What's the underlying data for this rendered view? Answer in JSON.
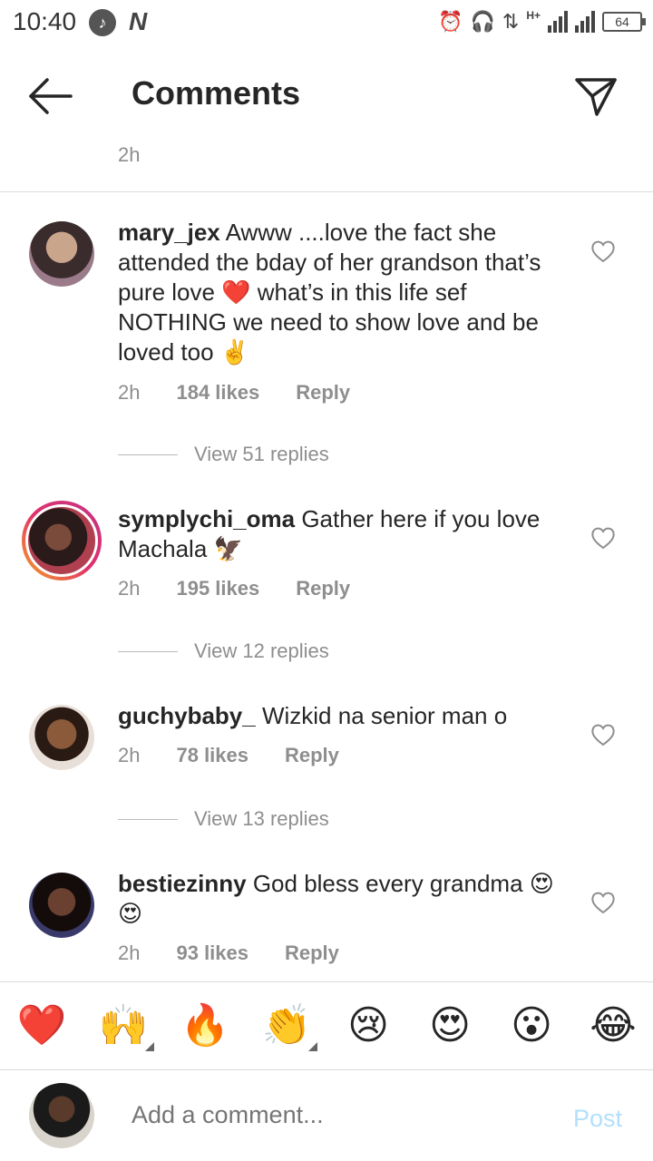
{
  "status_bar": {
    "time": "10:40",
    "network_type": "H+",
    "battery": "64",
    "app_indicator": "N",
    "icons": [
      "music-icon",
      "n-app-icon",
      "alarm-icon",
      "headphones-icon",
      "data-transfer-icon",
      "signal-icon",
      "battery-icon"
    ]
  },
  "header": {
    "title": "Comments",
    "back_icon": "arrow-left-icon",
    "share_icon": "send-paper-plane-icon"
  },
  "top_time": "2h",
  "comments": [
    {
      "username": "mary_jex",
      "text": "Awww ....love the fact she attended the bday of her grandson that’s pure love ❤️ what’s in this life sef NOTHING we need to show love and be loved too ✌️",
      "time": "2h",
      "likes": "184 likes",
      "reply": "Reply",
      "view_replies": "View 51 replies"
    },
    {
      "username": "symplychi_oma",
      "text": "Gather here if you love Machala 🦅",
      "time": "2h",
      "likes": "195 likes",
      "reply": "Reply",
      "view_replies": "View 12 replies",
      "has_story_ring": true
    },
    {
      "username": "guchybaby_",
      "text": "Wizkid na senior man o",
      "time": "2h",
      "likes": "78 likes",
      "reply": "Reply",
      "view_replies": "View 13 replies"
    },
    {
      "username": "bestiezinny",
      "text": "God bless every grandma 😍😍",
      "time": "2h",
      "likes": "93 likes",
      "reply": "Reply"
    }
  ],
  "emoji_bar": [
    "❤️",
    "🙌",
    "🔥",
    "👏",
    "😢",
    "😍",
    "😮",
    "😂"
  ],
  "add_comment": {
    "placeholder": "Add a comment...",
    "post_label": "Post"
  },
  "colors": {
    "text": "#262626",
    "secondary": "#8e8e8e",
    "post_disabled": "#b2dffc",
    "story_ring": "#e1306c"
  }
}
